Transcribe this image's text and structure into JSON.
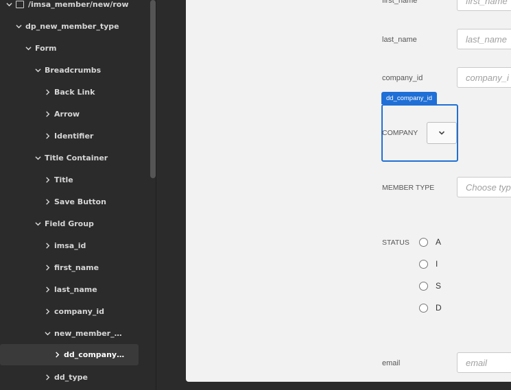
{
  "sidebar": {
    "items": [
      {
        "label": "/imsa_member/new/row",
        "expanded": true
      },
      {
        "label": "dp_new_member_type",
        "expanded": true
      },
      {
        "label": "Form",
        "expanded": true
      },
      {
        "label": "Breadcrumbs",
        "expanded": true
      },
      {
        "label": "Back Link",
        "expanded": false
      },
      {
        "label": "Arrow",
        "expanded": false
      },
      {
        "label": "Identifier",
        "expanded": false
      },
      {
        "label": "Title Container",
        "expanded": true
      },
      {
        "label": "Title",
        "expanded": false
      },
      {
        "label": "Save Button",
        "expanded": false
      },
      {
        "label": "Field Group",
        "expanded": true
      },
      {
        "label": "imsa_id",
        "expanded": false
      },
      {
        "label": "first_name",
        "expanded": false
      },
      {
        "label": "last_name",
        "expanded": false
      },
      {
        "label": "company_id",
        "expanded": false
      },
      {
        "label": "new_member_…",
        "expanded": true
      },
      {
        "label": "dd_company…",
        "expanded": false,
        "selected": true
      },
      {
        "label": "dd_type",
        "expanded": false
      }
    ]
  },
  "form": {
    "first_name": {
      "label": "first_name",
      "placeholder": "first_name"
    },
    "last_name": {
      "label": "last_name",
      "placeholder": "last_name"
    },
    "company_id": {
      "label": "company_id",
      "placeholder": "company_i"
    },
    "selection_tag": "dd_company_id",
    "company": {
      "label": "COMPANY"
    },
    "member_type": {
      "label": "MEMBER TYPE",
      "placeholder": "Choose typ"
    },
    "status": {
      "label": "STATUS",
      "options": [
        "A",
        "I",
        "S",
        "D"
      ]
    },
    "email": {
      "label": "email",
      "placeholder": "email"
    }
  },
  "colors": {
    "selection": "#1f6fd6",
    "sidebar_bg": "#2b2b2b",
    "panel_bg": "#f2f2f2"
  }
}
